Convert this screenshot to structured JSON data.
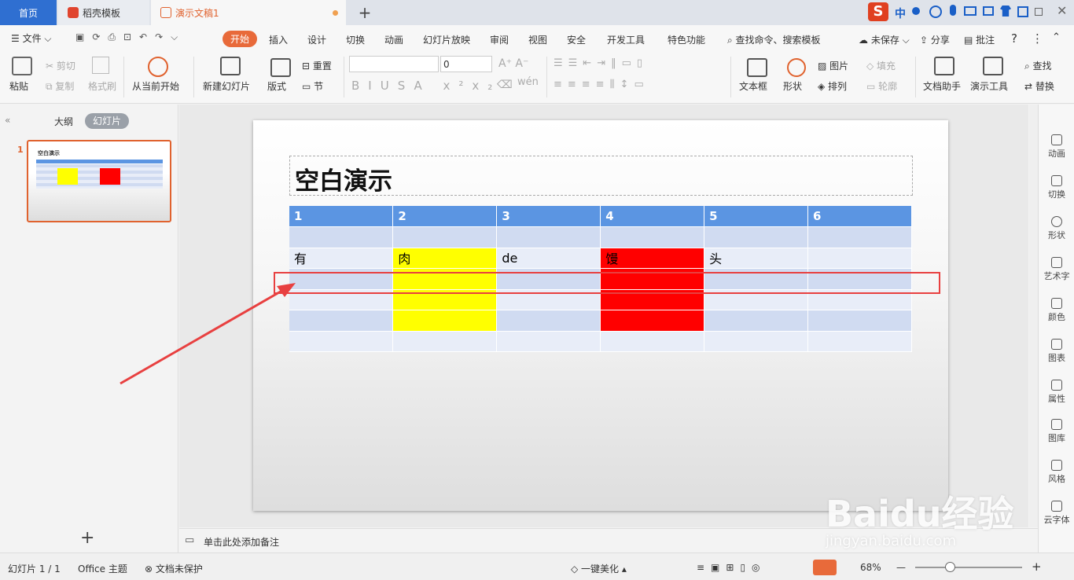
{
  "tabs": {
    "home": "首页",
    "template": "稻壳模板",
    "doc": "演示文稿1",
    "plus": "+"
  },
  "input_method": {
    "label": "中"
  },
  "menu": {
    "file": "文件",
    "start": "开始",
    "insert": "插入",
    "design": "设计",
    "transition": "切换",
    "animation": "动画",
    "slideshow": "幻灯片放映",
    "review": "审阅",
    "view": "视图",
    "security": "安全",
    "developer": "开发工具",
    "special": "特色功能",
    "search": "查找命令、搜索模板",
    "unsaved": "未保存",
    "share": "分享",
    "comment": "批注"
  },
  "ribbon": {
    "paste": "粘贴",
    "cut": "剪切",
    "copy": "复制",
    "format_painter": "格式刷",
    "from_current": "从当前开始",
    "new_slide": "新建幻灯片",
    "layout": "版式",
    "reset": "重置",
    "section": "节",
    "font_size": "0",
    "text_box": "文本框",
    "shape": "形状",
    "picture": "图片",
    "fill": "填充",
    "arrange": "排列",
    "outline": "轮廓",
    "doc_assistant": "文档助手",
    "present_tools": "演示工具",
    "find": "查找",
    "replace": "替换"
  },
  "left_pane": {
    "outline": "大纲",
    "slides": "幻灯片",
    "slide_no": "1",
    "add": "+"
  },
  "slide": {
    "title": "空白演示",
    "table": {
      "header": [
        "1",
        "2",
        "3",
        "4",
        "5",
        "6"
      ],
      "row2": [
        "有",
        "肉",
        "de",
        "馒",
        "头",
        ""
      ]
    }
  },
  "right_pane": [
    "动画",
    "切换",
    "形状",
    "艺术字",
    "颜色",
    "图表",
    "属性",
    "图库",
    "风格",
    "云字体"
  ],
  "notes": {
    "placeholder": "单击此处添加备注"
  },
  "status": {
    "slide_count": "幻灯片 1 / 1",
    "theme": "Office 主题",
    "protect": "文档未保护",
    "beautify": "一键美化",
    "zoom": "68%"
  },
  "watermark": {
    "brand": "Baidu经验",
    "url": "jingyan.baidu.com"
  },
  "colors": {
    "accent": "#e0622e",
    "header_blue": "#5b95e2",
    "yellow": "#ffff00",
    "red": "#ff0000",
    "highlight": "#e84040"
  }
}
